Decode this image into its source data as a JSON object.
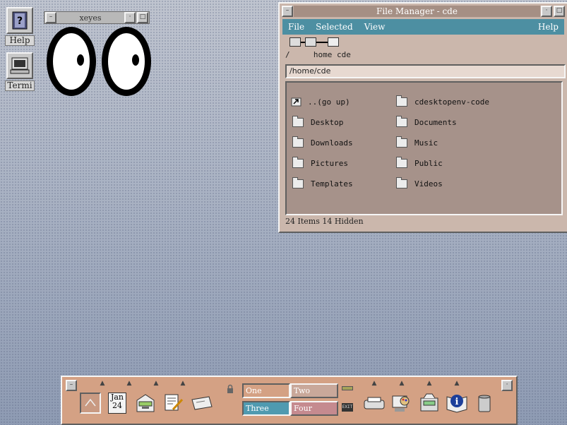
{
  "desktop_icons": [
    {
      "label": "Help",
      "icon": "help-book-icon"
    },
    {
      "label": "Termi",
      "icon": "terminal-icon"
    }
  ],
  "xeyes": {
    "title": "xeyes"
  },
  "file_manager": {
    "title": "File Manager - cde",
    "menu": [
      "File",
      "Selected",
      "View",
      "Help"
    ],
    "breadcrumb": [
      "/",
      "home",
      "cde"
    ],
    "path": "/home/cde",
    "items": [
      "..(go up)",
      "cdesktopenv-code",
      "Desktop",
      "Documents",
      "Downloads",
      "Music",
      "Pictures",
      "Public",
      "Templates",
      "Videos"
    ],
    "status": "24 Items 14 Hidden"
  },
  "front_panel": {
    "calendar": {
      "month": "Jan",
      "day": "24"
    },
    "workspaces": [
      {
        "label": "One",
        "color": "#7f99a8"
      },
      {
        "label": "Two",
        "color": "#c9a89a"
      },
      {
        "label": "Three",
        "color": "#4f9ab0"
      },
      {
        "label": "Four",
        "color": "#c58a8f"
      }
    ],
    "exit_label": "EXIT"
  }
}
